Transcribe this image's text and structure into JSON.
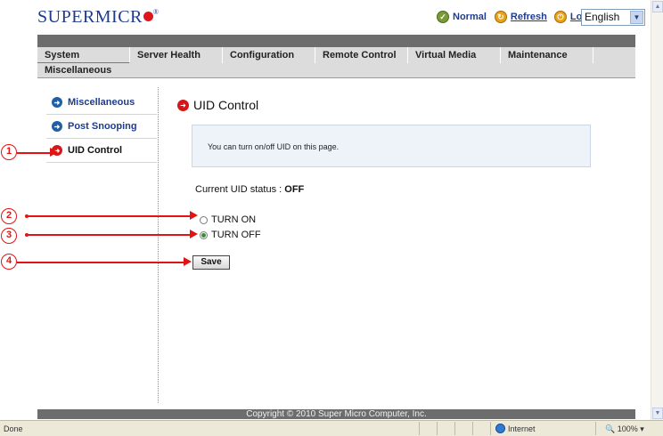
{
  "header": {
    "logo_text": "SUPERMICR",
    "logo_reg": "®",
    "status_normal": "Normal",
    "refresh": "Refresh",
    "logout": "Logout",
    "language": "English"
  },
  "menu": {
    "items": [
      "System",
      "Server Health",
      "Configuration",
      "Remote Control",
      "Virtual Media",
      "Maintenance"
    ],
    "sub": "Miscellaneous"
  },
  "sidebar": {
    "items": [
      "Miscellaneous",
      "Post Snooping",
      "UID Control"
    ]
  },
  "main": {
    "title": "UID Control",
    "info": "You can turn on/off UID on this page.",
    "status_label": "Current UID status : ",
    "status_value": "OFF",
    "radio_on": "TURN ON",
    "radio_off": "TURN OFF",
    "selected": "TURN OFF",
    "save": "Save"
  },
  "callouts": [
    "1",
    "2",
    "3",
    "4"
  ],
  "footer": {
    "copyright": "Copyright © 2010 Super Micro Computer, Inc."
  },
  "statusbar": {
    "left": "Done",
    "zone": "Internet",
    "zoom": "100%"
  },
  "colors": {
    "brand": "#1f3c8c",
    "accent_red": "#e01414",
    "menu_gray": "#dcdcdc",
    "footer_gray": "#6d6d6d"
  }
}
